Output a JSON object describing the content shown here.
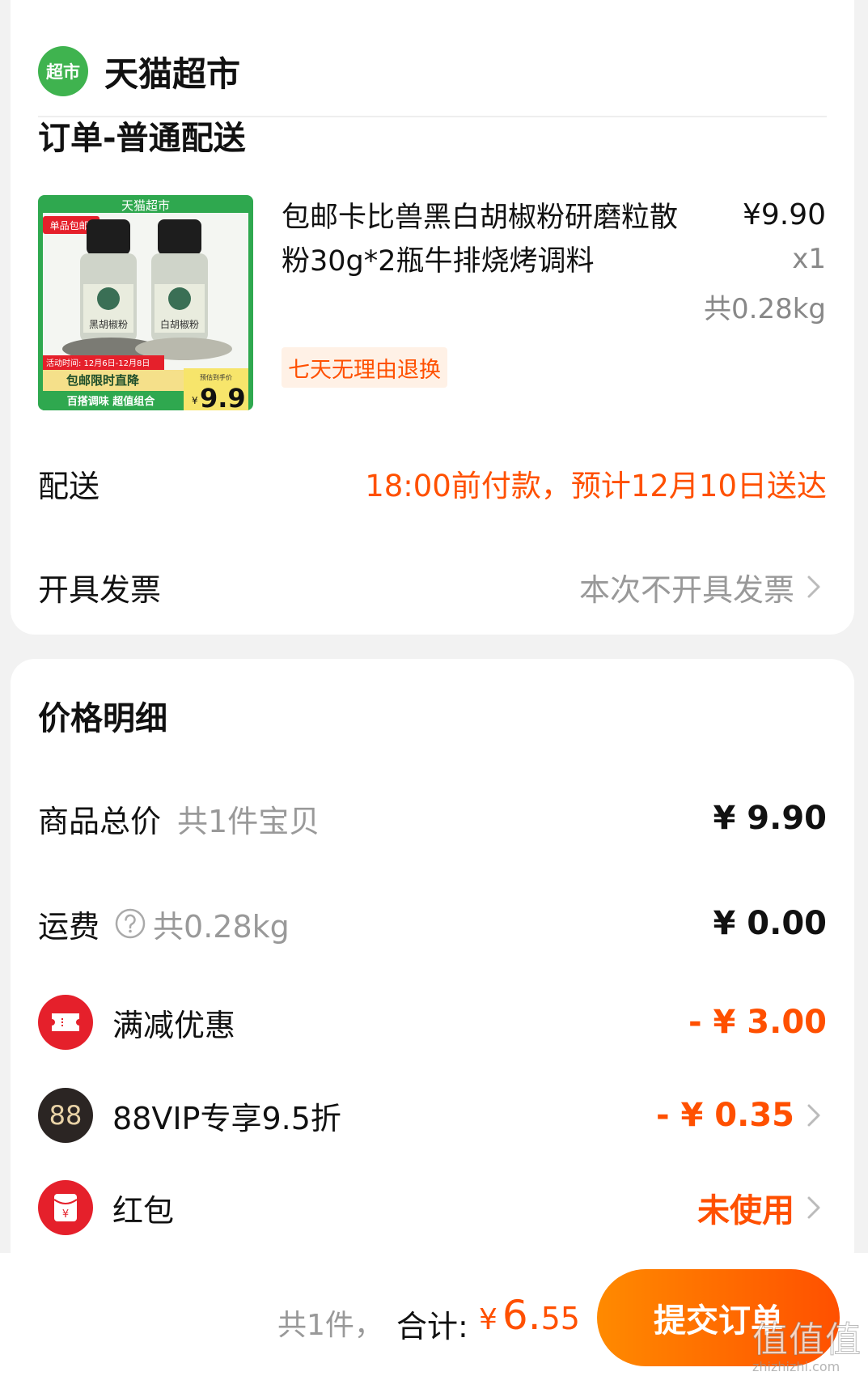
{
  "store": {
    "logo_text": "超市",
    "name": "天猫超市"
  },
  "order": {
    "section_title": "订单-普通配送",
    "product": {
      "name": "包邮卡比兽黑白胡椒粉研磨粒散粉30g*2瓶牛排烧烤调料",
      "price": "¥9.90",
      "quantity": "x1",
      "weight": "共0.28kg",
      "return_policy": "七天无理由退换",
      "image_texts": {
        "store": "天猫超市",
        "tag": "单品包邮!",
        "left_bottle": "黑胡椒粉",
        "right_bottle": "白胡椒粉",
        "activity": "活动时间: 12月6日-12月8日",
        "promo": "包邮限时直降",
        "combo": "百搭调味 超值组合",
        "est_label": "预估到手价",
        "est_yen": "¥",
        "est_price": "9.9"
      }
    },
    "delivery": {
      "label": "配送",
      "value": "18:00前付款，预计12月10日送达"
    },
    "invoice": {
      "label": "开具发票",
      "value": "本次不开具发票"
    }
  },
  "price_detail": {
    "title": "价格明细",
    "goods_total": {
      "label": "商品总价",
      "sub": "共1件宝贝",
      "value": "¥ 9.90"
    },
    "shipping": {
      "label": "运费",
      "sub": "共0.28kg",
      "value": "¥ 0.00"
    },
    "full_reduction": {
      "label": "满减优惠",
      "value": "- ¥ 3.00"
    },
    "vip": {
      "icon_text": "88",
      "label": "88VIP专享9.5折",
      "value": "- ¥ 0.35"
    },
    "red_packet": {
      "icon_text": "¥",
      "label": "红包",
      "value": "未使用"
    }
  },
  "bottom_bar": {
    "count": "共1件，",
    "total_label": "合计:",
    "total_yen": "¥",
    "total_int": "6.",
    "total_dec": "55",
    "submit_label": "提交订单"
  },
  "watermark": {
    "text": "值",
    "domain": "zhizhizhi.com"
  },
  "colors": {
    "accent": "#ff5000",
    "store_green": "#3fb34f",
    "red": "#e5202b",
    "vip_dark": "#2b2523"
  }
}
